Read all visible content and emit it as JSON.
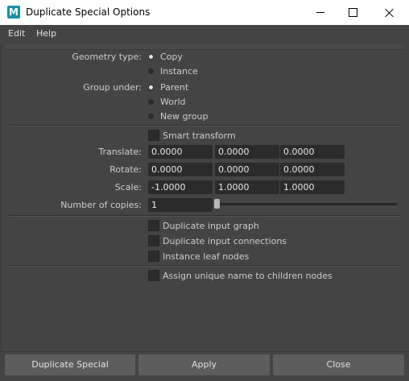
{
  "window": {
    "app_icon_letter": "M",
    "title": "Duplicate Special Options",
    "accent_color": "#1d8fa8"
  },
  "menu": {
    "items": [
      "Edit",
      "Help"
    ]
  },
  "geometry_type": {
    "label": "Geometry type:",
    "options": [
      "Copy",
      "Instance"
    ],
    "selected": "Copy"
  },
  "group_under": {
    "label": "Group under:",
    "options": [
      "Parent",
      "World",
      "New group"
    ],
    "selected": "Parent"
  },
  "smart_transform": {
    "label": "Smart transform",
    "checked": false
  },
  "translate": {
    "label": "Translate:",
    "values": [
      "0.0000",
      "0.0000",
      "0.0000"
    ]
  },
  "rotate": {
    "label": "Rotate:",
    "values": [
      "0.0000",
      "0.0000",
      "0.0000"
    ]
  },
  "scale": {
    "label": "Scale:",
    "values": [
      "-1.0000",
      "1.0000",
      "1.0000"
    ]
  },
  "copies": {
    "label": "Number of copies:",
    "value": "1"
  },
  "options": [
    {
      "label": "Duplicate input graph",
      "checked": false
    },
    {
      "label": "Duplicate input connections",
      "checked": false
    },
    {
      "label": "Instance leaf nodes",
      "checked": false
    }
  ],
  "unique_name": {
    "label": "Assign unique name to children nodes",
    "checked": false
  },
  "buttons": {
    "duplicate": "Duplicate Special",
    "apply": "Apply",
    "close": "Close"
  }
}
